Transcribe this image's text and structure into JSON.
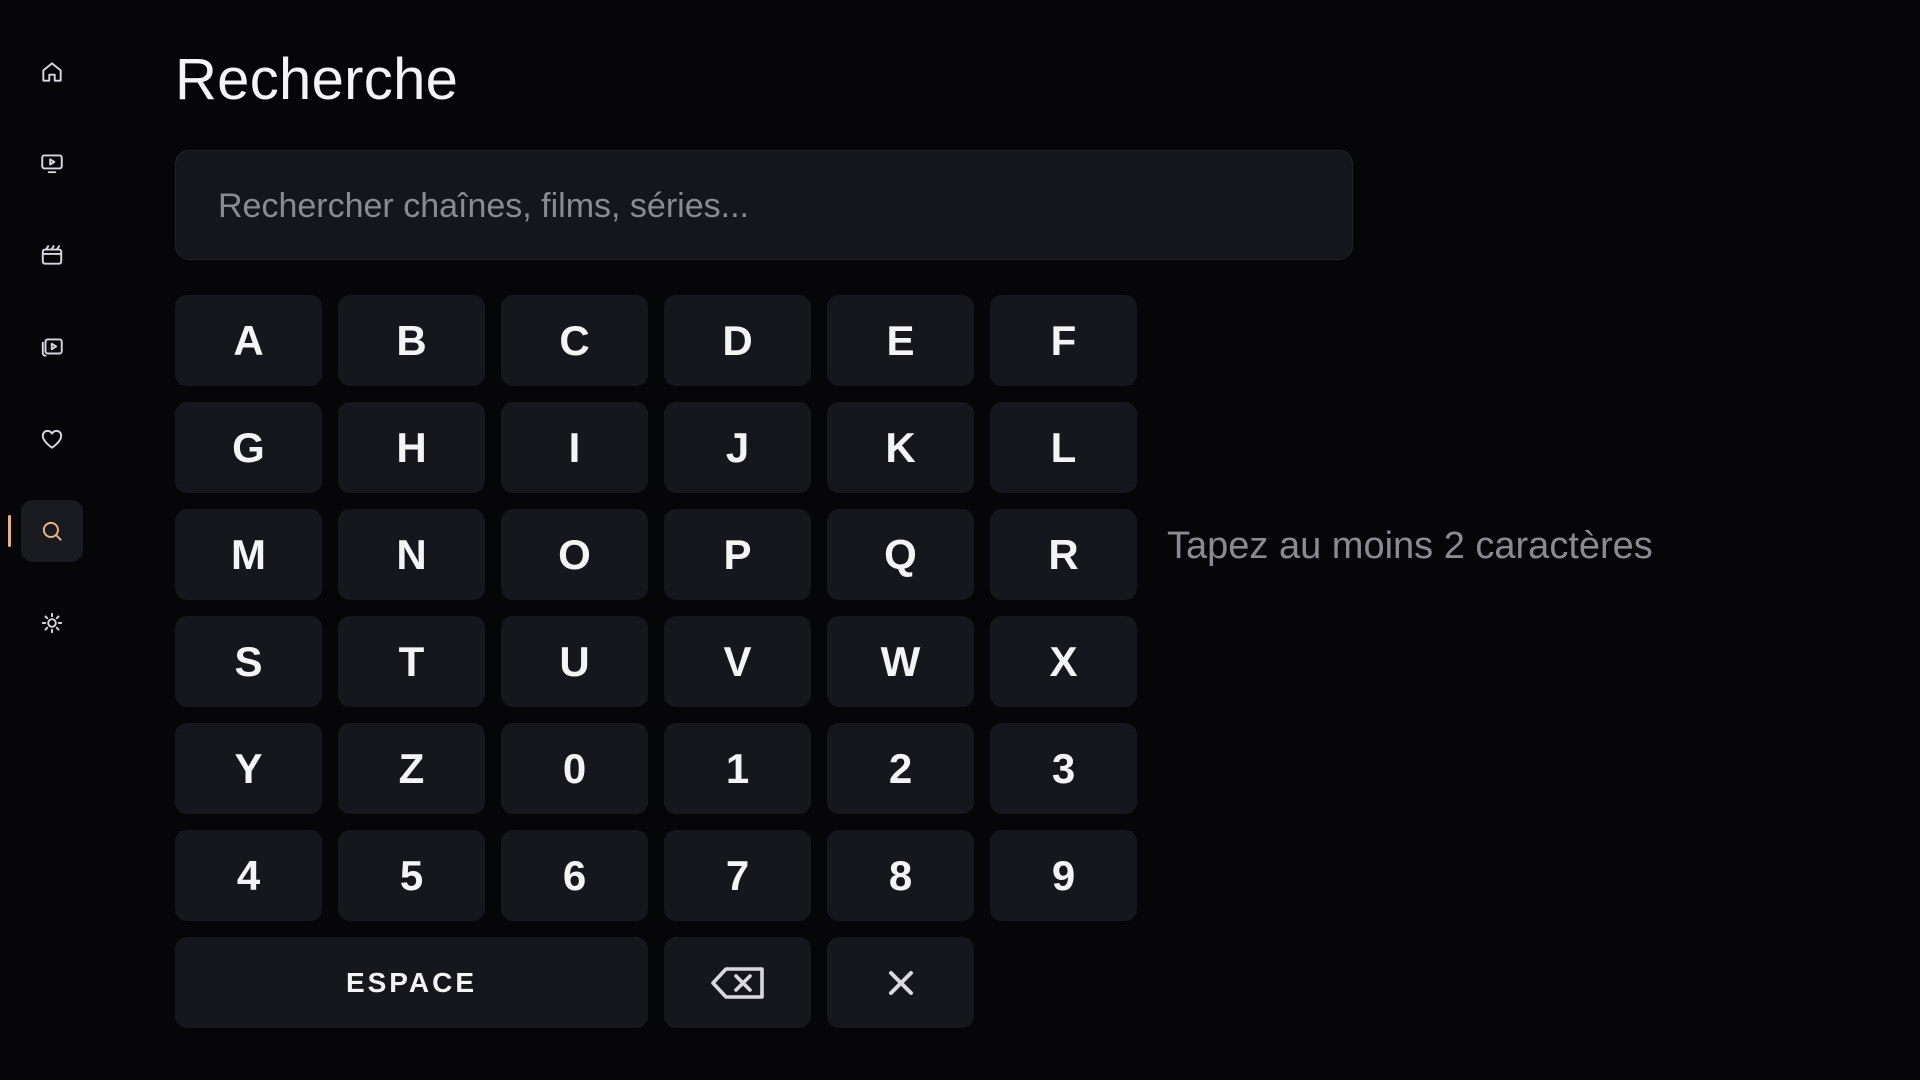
{
  "sidebar": {
    "items": [
      {
        "icon": "home-icon",
        "active": false
      },
      {
        "icon": "tv-icon",
        "active": false
      },
      {
        "icon": "movie-icon",
        "active": false
      },
      {
        "icon": "series-icon",
        "active": false
      },
      {
        "icon": "heart-icon",
        "active": false
      },
      {
        "icon": "search-icon",
        "active": true
      },
      {
        "icon": "settings-icon",
        "active": false
      }
    ],
    "accent_color": "#e8b67d"
  },
  "page": {
    "title": "Recherche"
  },
  "search": {
    "value": "",
    "placeholder": "Rechercher chaînes, films, séries..."
  },
  "keyboard": {
    "rows": [
      [
        "A",
        "B",
        "C",
        "D",
        "E",
        "F"
      ],
      [
        "G",
        "H",
        "I",
        "J",
        "K",
        "L"
      ],
      [
        "M",
        "N",
        "O",
        "P",
        "Q",
        "R"
      ],
      [
        "S",
        "T",
        "U",
        "V",
        "W",
        "X"
      ],
      [
        "Y",
        "Z",
        "0",
        "1",
        "2",
        "3"
      ],
      [
        "4",
        "5",
        "6",
        "7",
        "8",
        "9"
      ]
    ],
    "space_label": "ESPACE",
    "backspace_icon": "backspace-icon",
    "clear_icon": "clear-icon"
  },
  "hint": "Tapez au moins 2 caractères"
}
